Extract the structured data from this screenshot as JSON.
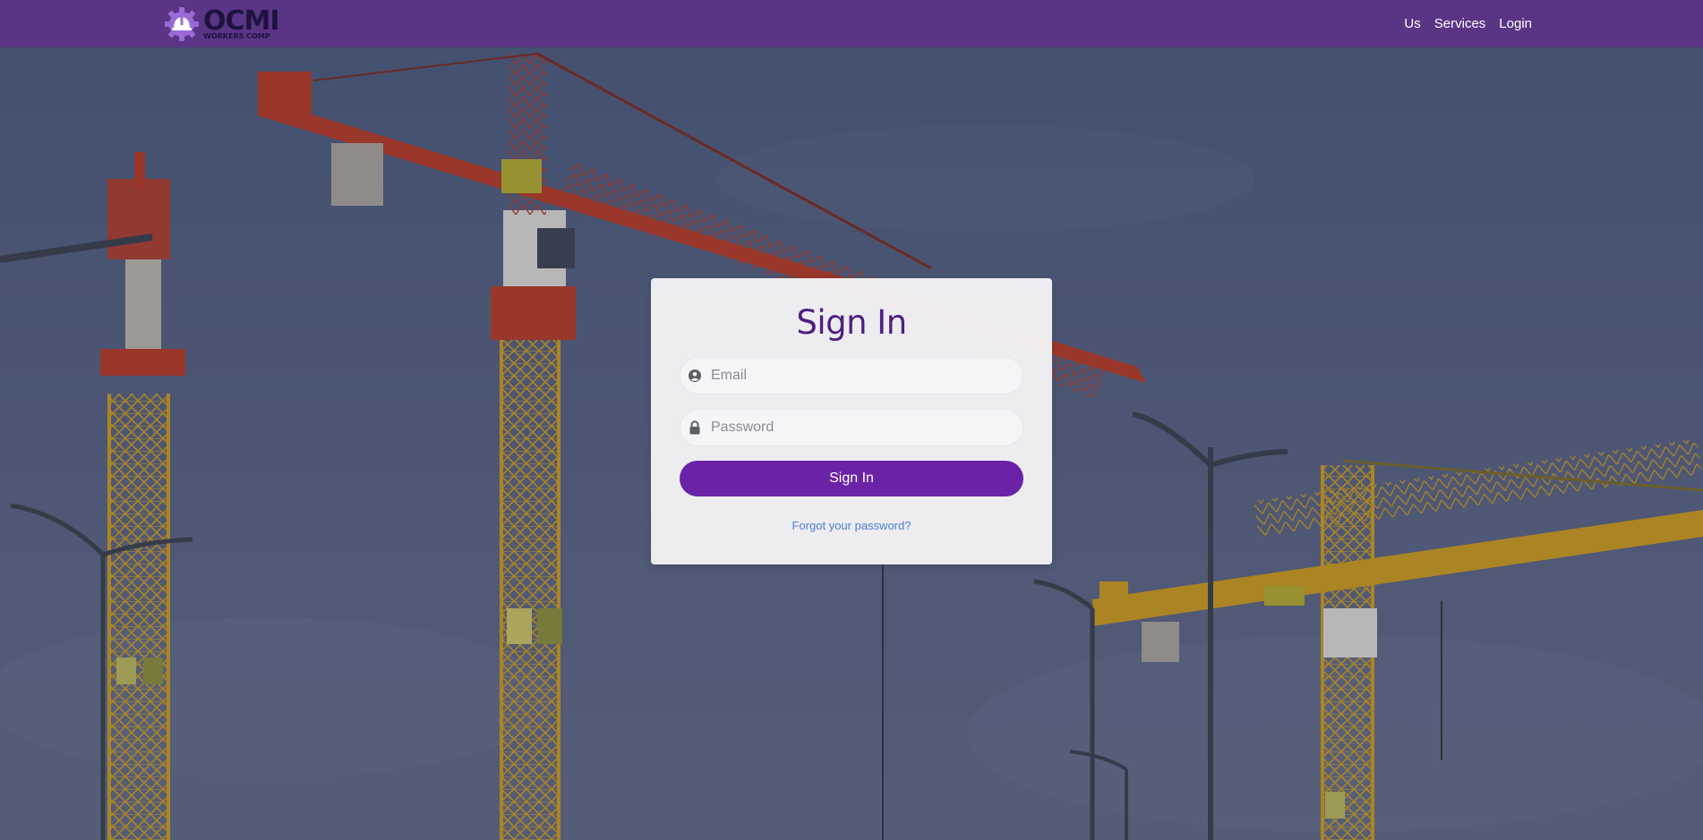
{
  "brand": {
    "name": "OCMI",
    "subtitle": "WORKERS COMP"
  },
  "nav": {
    "links": [
      {
        "label": "Us"
      },
      {
        "label": "Services"
      },
      {
        "label": "Login"
      }
    ]
  },
  "signin": {
    "title": "Sign In",
    "email_placeholder": "Email",
    "password_placeholder": "Password",
    "submit_label": "Sign In",
    "forgot_label": "Forgot your password?"
  },
  "colors": {
    "navbar": "#5a3585",
    "brand_dark": "#1e1240",
    "accent": "#6a22a6",
    "title": "#4e1f82",
    "link": "#4b7fd1"
  },
  "icons": {
    "email": "user-circle-icon",
    "password": "lock-icon",
    "logo": "gear-hardhat-icon"
  }
}
